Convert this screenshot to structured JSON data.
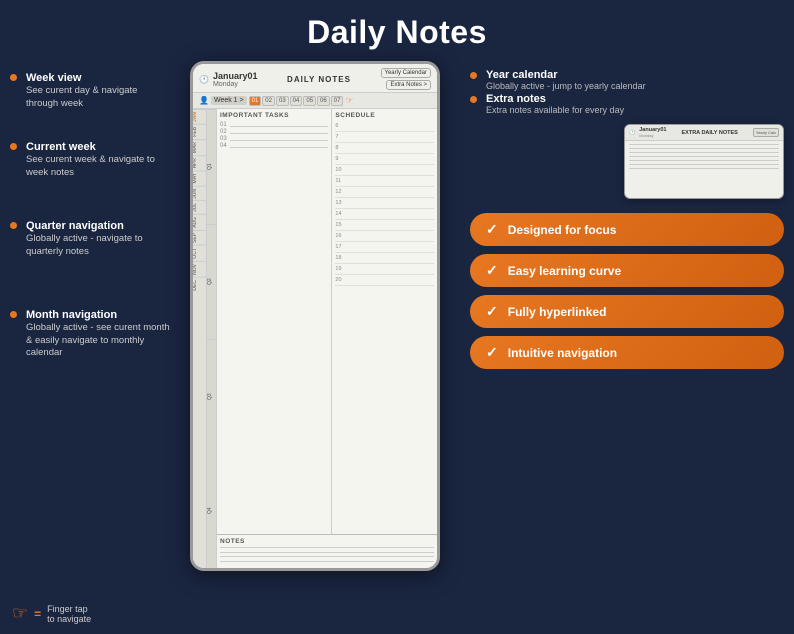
{
  "page": {
    "title": "Daily Notes",
    "bg_color": "#1a2540"
  },
  "device": {
    "header": {
      "date": "January01",
      "day": "Monday",
      "label": "DAILY NOTES",
      "yearly_btn": "Yearly Calendar",
      "extra_btn": "Extra Notes >"
    },
    "week": {
      "label": "Week 1 >",
      "days": [
        "01",
        "02",
        "03",
        "04",
        "05",
        "06",
        "07"
      ],
      "active_day": "01"
    },
    "tasks": {
      "header": "IMPORTANT TASKS",
      "rows": [
        "01",
        "02",
        "03",
        "04"
      ]
    },
    "schedule": {
      "header": "SCHEDULE",
      "times": [
        "6",
        "7",
        "8",
        "9",
        "10",
        "11",
        "12",
        "13",
        "14",
        "15",
        "16",
        "17",
        "18",
        "19",
        "20"
      ]
    },
    "notes": {
      "header": "NOTES",
      "lines": 4
    },
    "months": [
      "JAN",
      "FEB",
      "MAR",
      "APR",
      "MAY",
      "JUN",
      "JUL",
      "AUG",
      "SEP",
      "OCT",
      "NOV",
      "DEC"
    ],
    "quarters": [
      "Q1",
      "Q2",
      "Q3",
      "Q4"
    ]
  },
  "left_annotations": [
    {
      "title": "Week view",
      "desc": "See curent day & navigate through week"
    },
    {
      "title": "Current week",
      "desc": "See curent week & navigate to week notes"
    },
    {
      "title": "Quarter navigation",
      "desc": "Globally active - navigate to quarterly notes"
    },
    {
      "title": "Month navigation",
      "desc": "Globally active - see curent month & easily navigate to monthly calendar"
    }
  ],
  "right_annotations": {
    "year_calendar": {
      "title": "Year calendar",
      "desc": "Globally active - jump to yearly calendar"
    },
    "extra_notes": {
      "title": "Extra notes",
      "desc": "Extra notes available for every day"
    }
  },
  "extra_device": {
    "date": "January01",
    "label": "EXTRA DAILY NOTES"
  },
  "features": [
    {
      "label": "Designed for focus"
    },
    {
      "label": "Easy learning curve"
    },
    {
      "label": "Fully hyperlinked"
    },
    {
      "label": "Intuitive navigation"
    }
  ],
  "footer": {
    "icon": "☞",
    "equals": "=",
    "text": "Finger tap\nto navigate"
  }
}
